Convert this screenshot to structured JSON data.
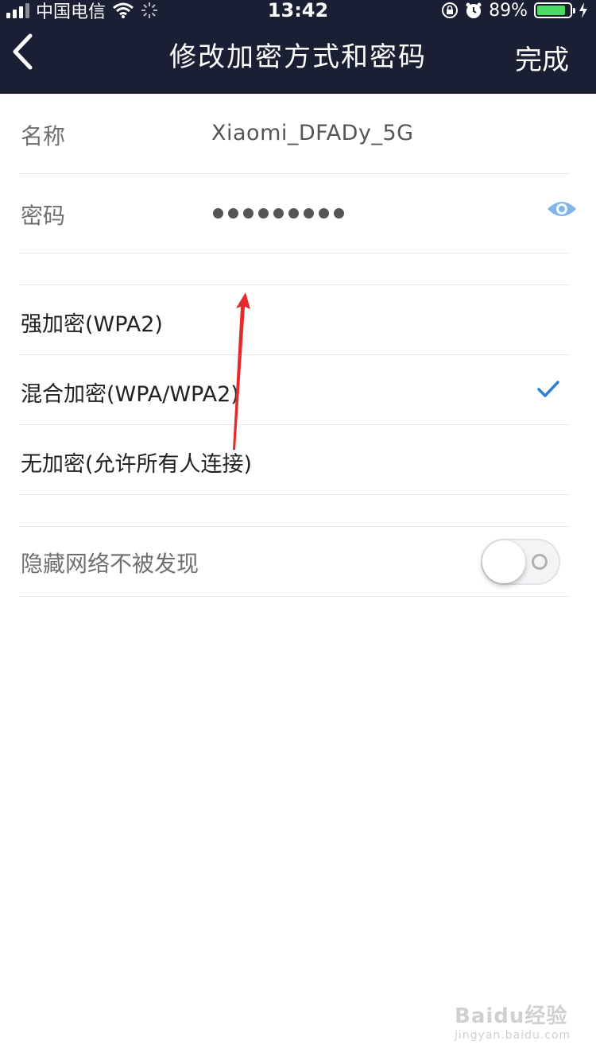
{
  "status_bar": {
    "carrier": "中国电信",
    "time": "13:42",
    "battery_percent": "89%",
    "battery_level": 0.89,
    "icons": [
      "signal-icon",
      "wifi-icon",
      "loading-spinner-icon",
      "orientation-lock-icon",
      "alarm-icon",
      "battery-icon",
      "charging-bolt-icon"
    ]
  },
  "nav": {
    "title": "修改加密方式和密码",
    "done_label": "完成",
    "back_icon": "chevron-left-icon"
  },
  "form": {
    "name_label": "名称",
    "name_value": "Xiaomi_DFADy_5G",
    "password_label": "密码",
    "password_masked": "●●●●●●●●●",
    "eye_icon": "eye-icon"
  },
  "encryption_options": [
    {
      "label": "强加密(WPA2)",
      "selected": false
    },
    {
      "label": "混合加密(WPA/WPA2)",
      "selected": true
    },
    {
      "label": "无加密(允许所有人连接)",
      "selected": false
    }
  ],
  "hidden_network": {
    "label": "隐藏网络不被发现",
    "enabled": false
  },
  "watermark": {
    "brand": "Baidu经验",
    "url": "jingyan.baidu.com"
  },
  "colors": {
    "header_bg": "#1b1f33",
    "accent": "#2e7fd0",
    "eye": "#7fb5e8",
    "annotation_arrow": "#e32b2b"
  }
}
